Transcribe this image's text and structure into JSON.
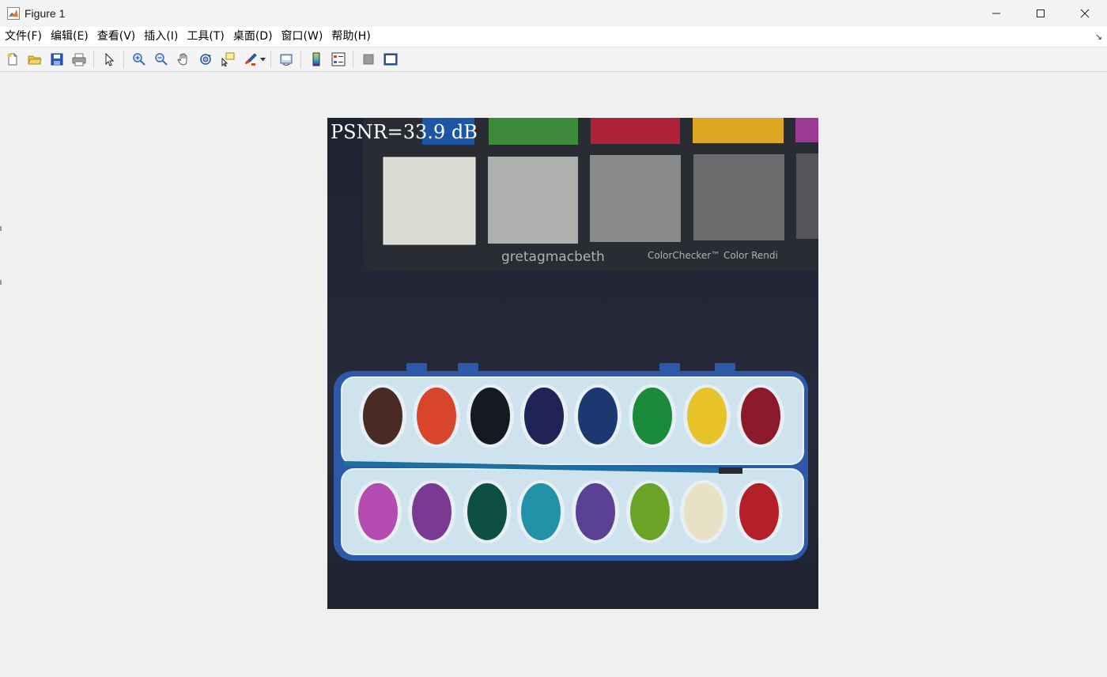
{
  "window": {
    "title": "Figure 1"
  },
  "menu": [
    "文件(F)",
    "编辑(E)",
    "查看(V)",
    "插入(I)",
    "工具(T)",
    "桌面(D)",
    "窗口(W)",
    "帮助(H)"
  ],
  "toolbar": {
    "icons": [
      "new-figure-icon",
      "open-file-icon",
      "save-icon",
      "print-icon",
      "edit-plot-icon",
      "zoom-in-icon",
      "zoom-out-icon",
      "pan-icon",
      "rotate-3d-icon",
      "data-cursor-icon",
      "brush-icon",
      "link-plot-icon",
      "insert-colorbar-icon",
      "insert-legend-icon",
      "hide-plot-tools-icon",
      "show-plot-tools-icon"
    ]
  },
  "image": {
    "annotation": "PSNR=33.9 dB",
    "chart_texts": [
      "gretagmacbeth",
      "ColorChecker™ Color Rendi"
    ],
    "colors": {
      "background": "#1f2230",
      "palette_top_row": [
        "#4a2a25",
        "#d8452a",
        "#151a22",
        "#1f2355",
        "#1c3870",
        "#1b8a3a",
        "#e7c228",
        "#8d1a2a"
      ],
      "palette_bottom_row": [
        "#b44bb0",
        "#7a3a92",
        "#0d4f40",
        "#2391a6",
        "#5b4196",
        "#6aa326",
        "#e8e1c5",
        "#b42029"
      ]
    }
  }
}
